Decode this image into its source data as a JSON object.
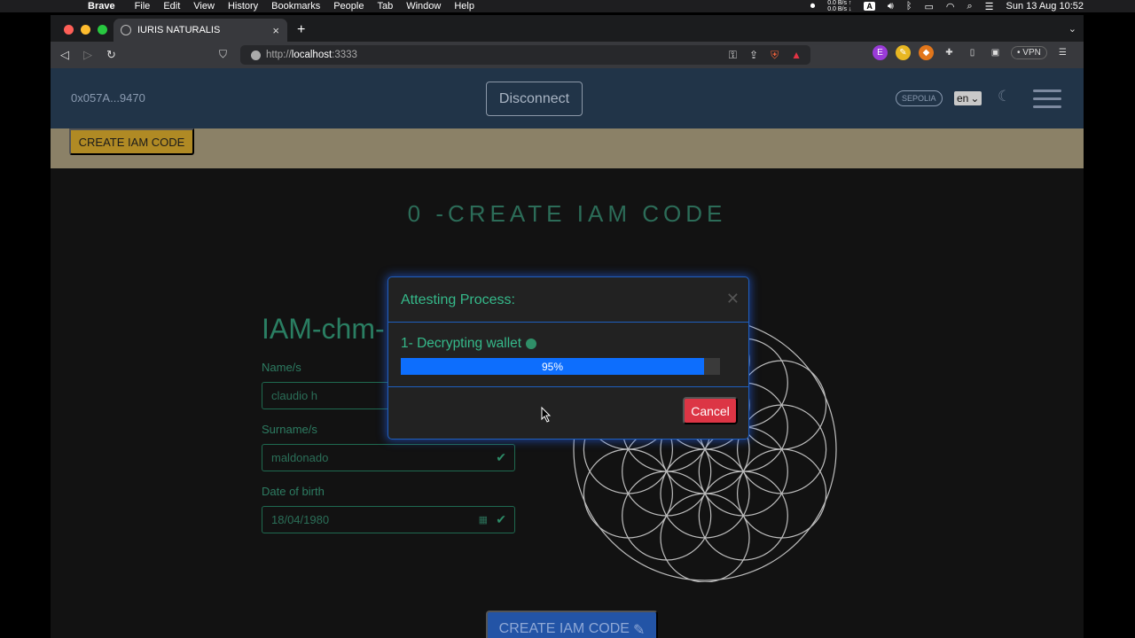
{
  "menubar": {
    "app_name": "Brave",
    "items": [
      "File",
      "Edit",
      "View",
      "History",
      "Bookmarks",
      "People",
      "Tab",
      "Window",
      "Help"
    ],
    "net_up": "0.0 B/s ↑",
    "net_down": "0.0 B/s ↓",
    "input_source": "A",
    "datetime": "Sun 13 Aug  10:52"
  },
  "browser": {
    "tab_title": "IURIS NATURALIS",
    "url_scheme": "http://",
    "url_host": "localhost",
    "url_port": ":3333",
    "vpn_label": "VPN"
  },
  "header": {
    "address": "0x057A...9470",
    "disconnect_label": "Disconnect",
    "network": "SEPOLIA",
    "language": "en"
  },
  "banner": {
    "button_label": "CREATE IAM CODE"
  },
  "main": {
    "title": "0 -CREATE IAM CODE",
    "form_heading": "IAM-chm-",
    "fields": [
      {
        "label": "Name/s",
        "value": "claudio h"
      },
      {
        "label": "Surname/s",
        "value": "maldonado"
      },
      {
        "label": "Date of birth",
        "value": "18/04/1980"
      }
    ],
    "submit_label": "CREATE IAM CODE"
  },
  "modal": {
    "title": "Attesting Process:",
    "step": "1- Decrypting wallet",
    "progress_text": "95%",
    "progress_value": 0.95,
    "cancel_label": "Cancel"
  },
  "colors": {
    "accent_green": "#35b98a",
    "progress_blue": "#0d6efd",
    "cancel_red": "#dc3545",
    "header_bg": "#213448",
    "banner_bg": "#8b8167"
  }
}
